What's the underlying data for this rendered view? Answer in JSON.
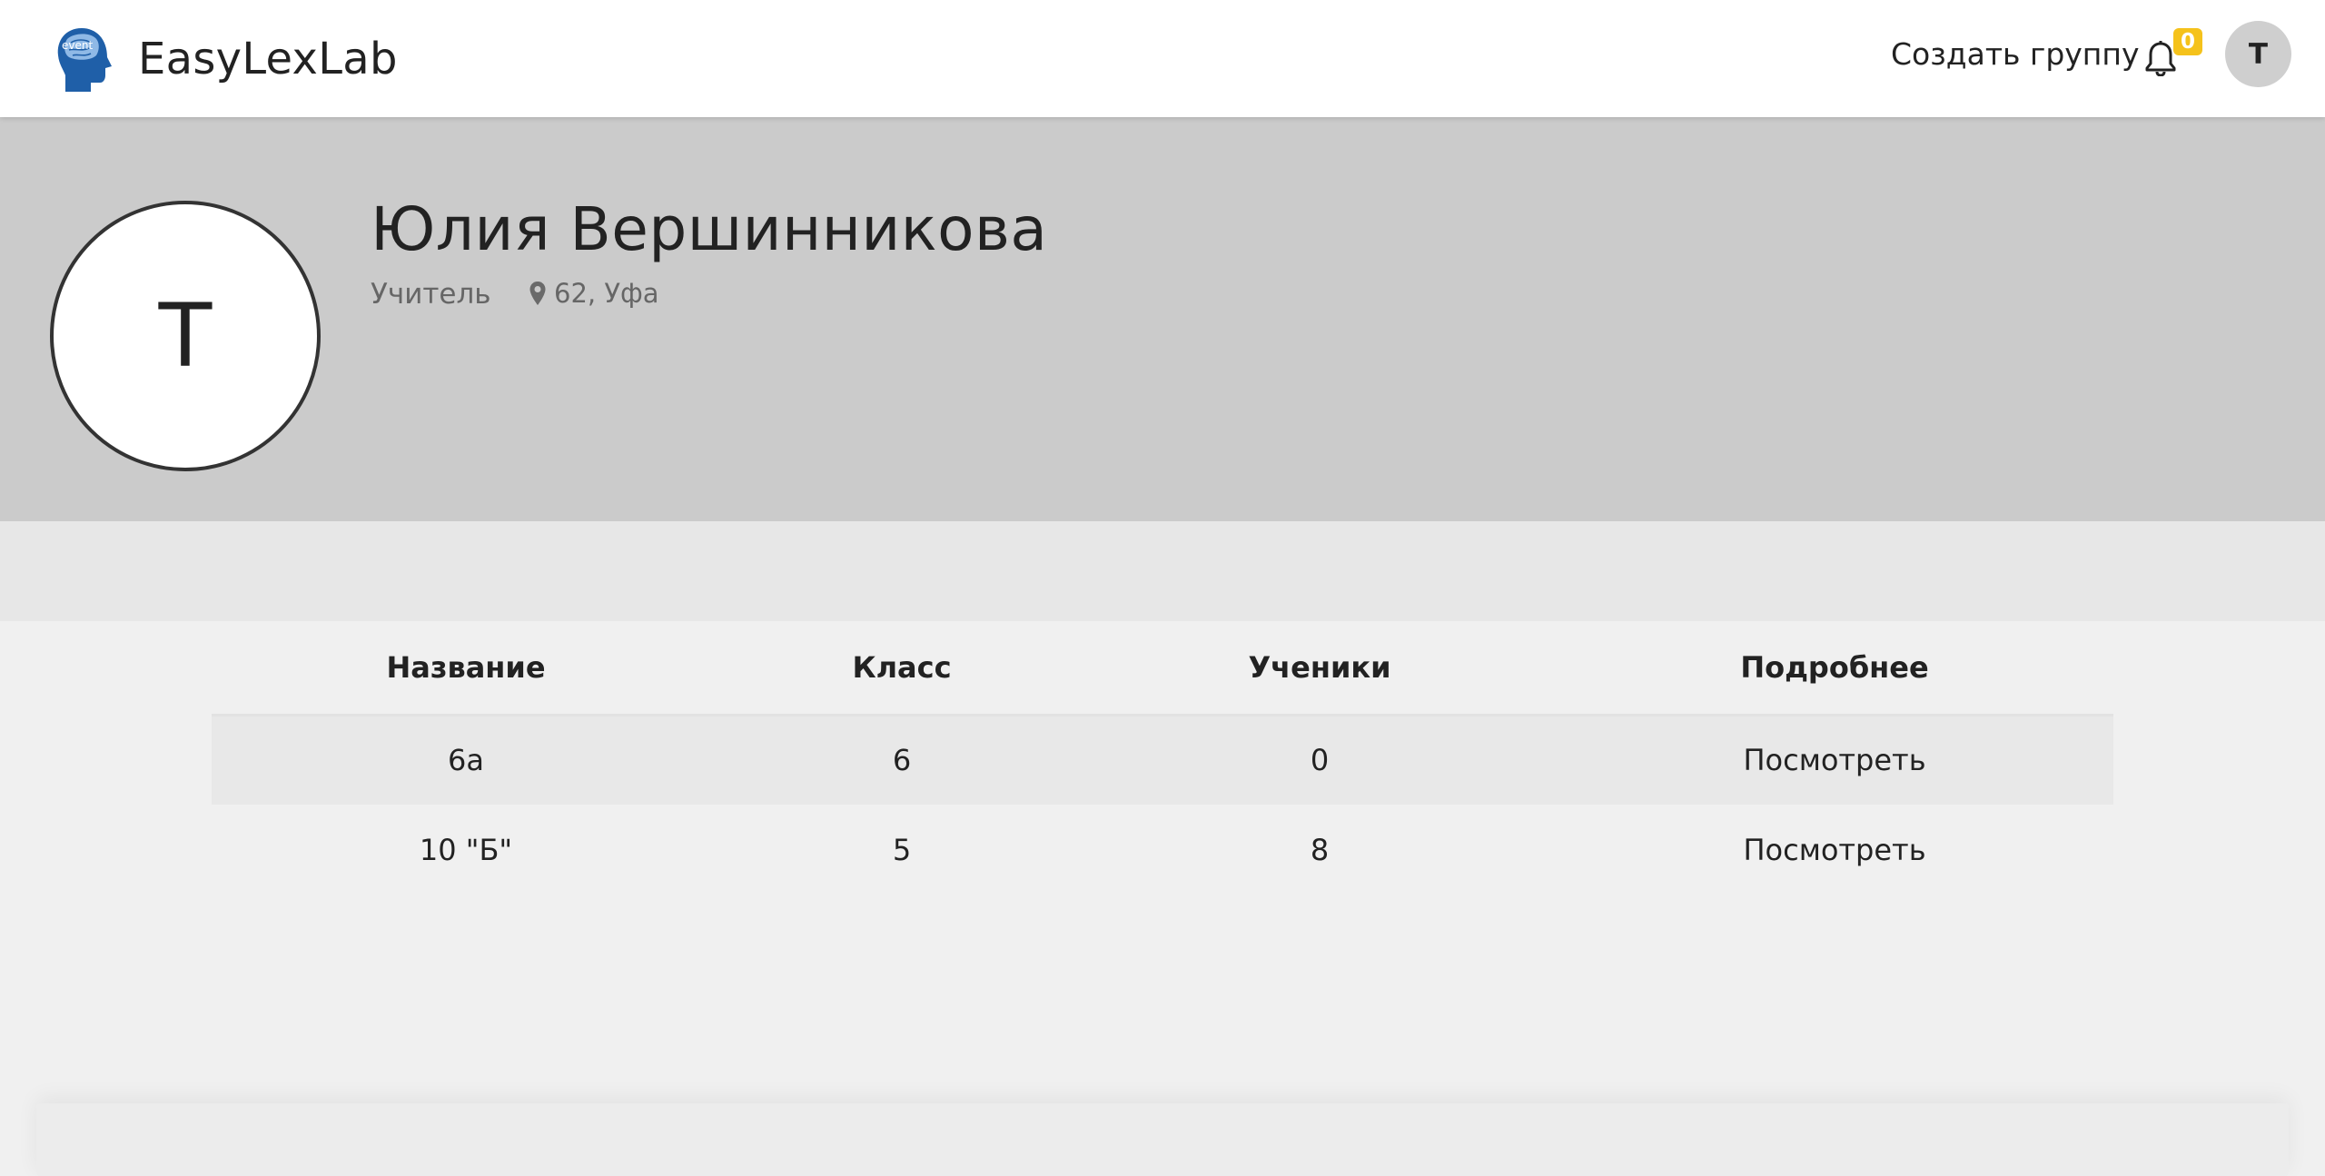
{
  "header": {
    "brand_name": "EasyLexLab",
    "logo_text": "event",
    "create_group_label": "Создать группу",
    "notification_count": "0",
    "user_initial": "T"
  },
  "profile": {
    "avatar_initial": "T",
    "name": "Юлия Вершинникова",
    "role": "Учитель",
    "location": "62, Уфа"
  },
  "groups_table": {
    "columns": [
      "Название",
      "Класс",
      "Ученики",
      "Подробнее"
    ],
    "rows": [
      {
        "name": "6а",
        "class": "6",
        "students": "0",
        "details": "Посмотреть"
      },
      {
        "name": "10 \"Б\"",
        "class": "5",
        "students": "8",
        "details": "Посмотреть"
      }
    ]
  },
  "colors": {
    "banner_bg": "#cbcbcb",
    "badge": "#f5c21b",
    "logo_blue": "#1f5fa8"
  }
}
